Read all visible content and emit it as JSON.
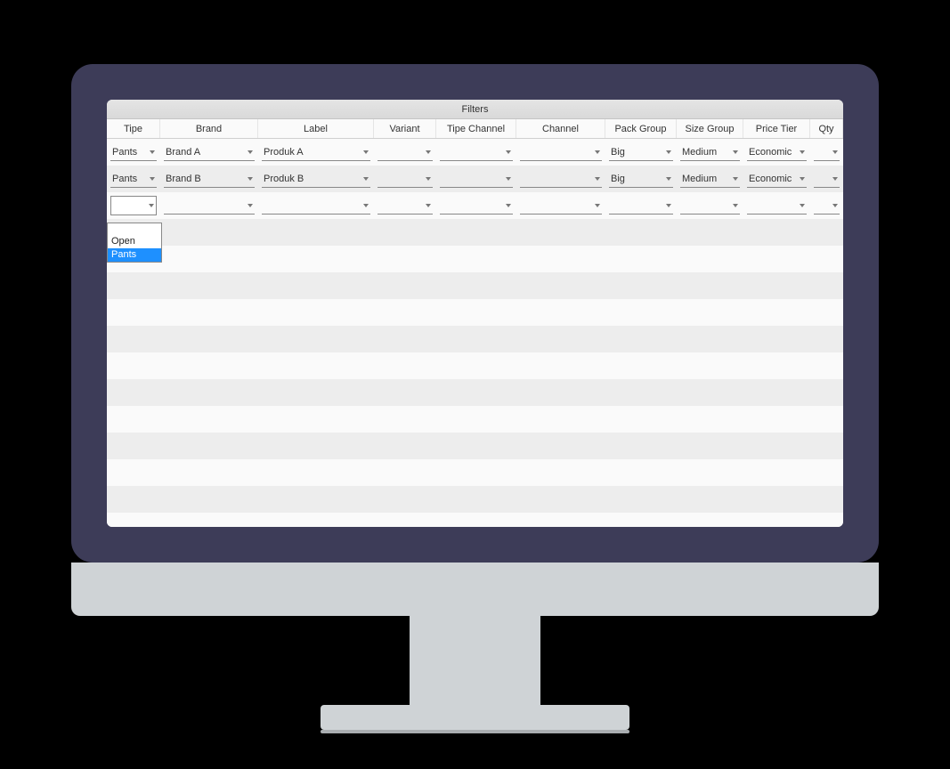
{
  "header": {
    "title": "Filters"
  },
  "columns": [
    {
      "key": "tipe",
      "label": "Tipe"
    },
    {
      "key": "brand",
      "label": "Brand"
    },
    {
      "key": "label",
      "label": "Label"
    },
    {
      "key": "variant",
      "label": "Variant"
    },
    {
      "key": "tipechannel",
      "label": "Tipe Channel"
    },
    {
      "key": "channel",
      "label": "Channel"
    },
    {
      "key": "packgroup",
      "label": "Pack Group"
    },
    {
      "key": "sizegroup",
      "label": "Size Group"
    },
    {
      "key": "pricetier",
      "label": "Price Tier"
    },
    {
      "key": "qty",
      "label": "Qty"
    }
  ],
  "rows": [
    {
      "tipe": "Pants",
      "brand": "Brand A",
      "label": "Produk A",
      "variant": "",
      "tipechannel": "",
      "channel": "",
      "packgroup": "Big",
      "sizegroup": "Medium",
      "pricetier": "Economic",
      "qty": ""
    },
    {
      "tipe": "Pants",
      "brand": "Brand B",
      "label": "Produk B",
      "variant": "",
      "tipechannel": "",
      "channel": "",
      "packgroup": "Big",
      "sizegroup": "Medium",
      "pricetier": "Economic",
      "qty": ""
    },
    {
      "tipe": "",
      "brand": "",
      "label": "",
      "variant": "",
      "tipechannel": "",
      "channel": "",
      "packgroup": "",
      "sizegroup": "",
      "pricetier": "",
      "qty": ""
    }
  ],
  "dropdown": {
    "options": [
      "",
      "Open",
      "Pants"
    ],
    "selected_index": 2
  }
}
